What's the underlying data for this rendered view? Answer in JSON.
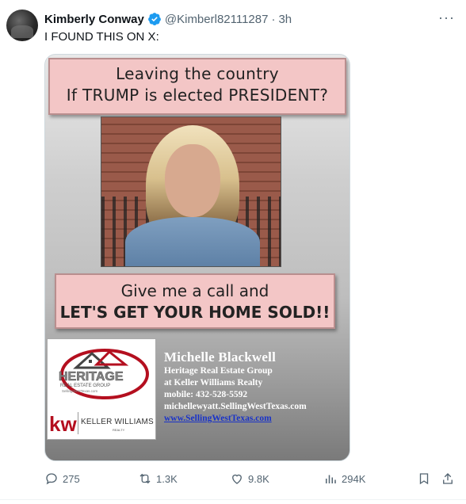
{
  "post": {
    "author_name": "Kimberly Conway",
    "handle": "@Kimberl82111287",
    "separator": "·",
    "time": "3h",
    "text": "I FOUND THIS ON X:",
    "more_label": "···"
  },
  "ad": {
    "banner_top_line1": "Leaving the country",
    "banner_top_line2": "If TRUMP is elected PRESIDENT?",
    "banner_bottom_line1": "Give me a call and",
    "banner_bottom_line2": "LET'S GET YOUR HOME SOLD!!",
    "heritage_logo_text": "HERITAGE",
    "heritage_logo_sub": "REAL ESTATE GROUP",
    "heritage_logo_url": "SellingWestTexas.com",
    "kw_mark": "kw",
    "kw_name": "KELLER WILLIAMS",
    "kw_sub": "REALTY",
    "agent_name": "Michelle Blackwell",
    "agent_line1": "Heritage Real Estate Group",
    "agent_line2": "at Keller Williams Realty",
    "agent_line3": "mobile: 432-528-5592",
    "agent_line4": "michellewyatt.SellingWestTexas.com",
    "agent_link": "www.SellingWestTexas.com"
  },
  "actions": {
    "replies": "275",
    "reposts": "1.3K",
    "likes": "9.8K",
    "views": "294K"
  },
  "colors": {
    "verified": "#1d9bf0",
    "secondary_text": "#536471",
    "banner_pink": "#f3c6c6",
    "kw_red": "#b40f1f",
    "link_blue": "#1a33c8"
  }
}
